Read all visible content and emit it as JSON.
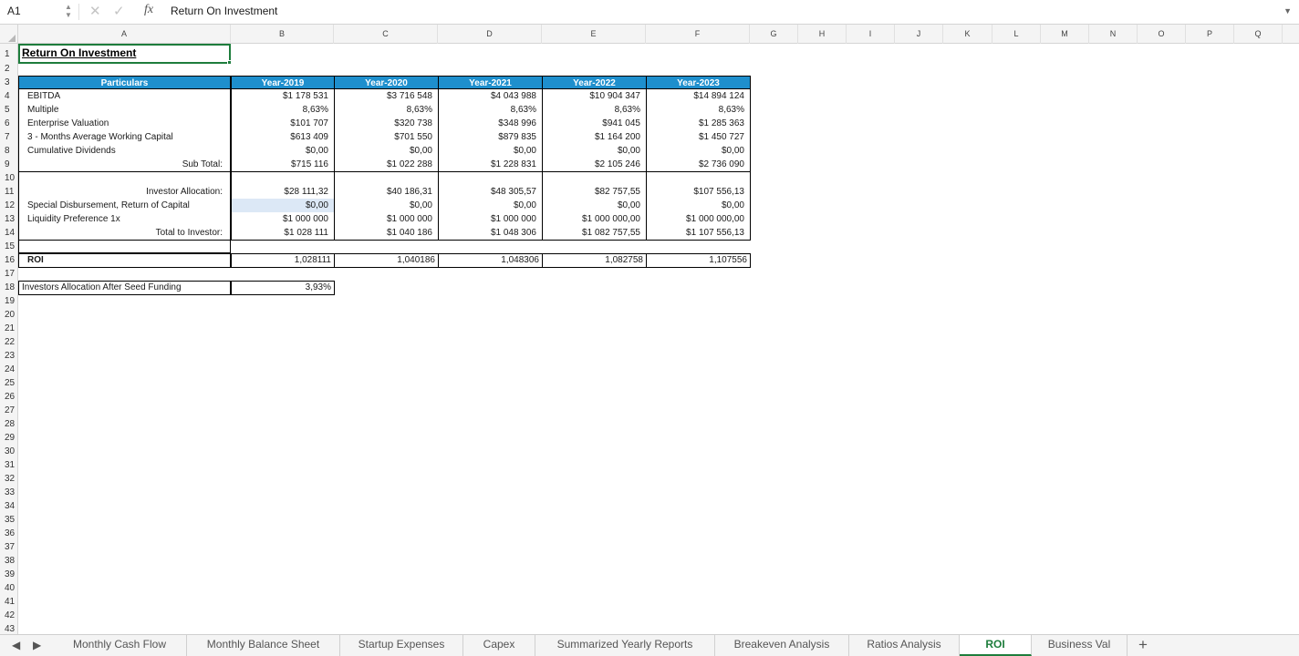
{
  "formula_bar": {
    "cell_ref": "A1",
    "formula_icon": "fx",
    "value": "Return On Investment"
  },
  "columns": [
    "A",
    "B",
    "C",
    "D",
    "E",
    "F",
    "G",
    "H",
    "I",
    "J",
    "K",
    "L",
    "M",
    "N",
    "O",
    "P",
    "Q"
  ],
  "rows": [
    "1",
    "2",
    "3",
    "4",
    "5",
    "6",
    "7",
    "8",
    "9",
    "10",
    "11",
    "12",
    "13",
    "14",
    "15",
    "16",
    "17",
    "18",
    "19",
    "20",
    "21",
    "22",
    "23",
    "24",
    "25",
    "26",
    "27",
    "28",
    "29",
    "30",
    "31",
    "32",
    "33",
    "34",
    "35",
    "36",
    "37",
    "38",
    "39",
    "40",
    "41",
    "42",
    "43"
  ],
  "sheet": {
    "title": "Return On Investment",
    "header": {
      "particulars": "Particulars",
      "years": [
        "Year-2019",
        "Year-2020",
        "Year-2021",
        "Year-2022",
        "Year-2023"
      ]
    },
    "rows": [
      {
        "label": "EBITDA",
        "values": [
          "$1 178 531",
          "$3 716 548",
          "$4 043 988",
          "$10 904 347",
          "$14 894 124"
        ]
      },
      {
        "label": "Multiple",
        "values": [
          "8,63%",
          "8,63%",
          "8,63%",
          "8,63%",
          "8,63%"
        ]
      },
      {
        "label": "Enterprise Valuation",
        "values": [
          "$101 707",
          "$320 738",
          "$348 996",
          "$941 045",
          "$1 285 363"
        ]
      },
      {
        "label": "3 - Months Average Working Capital",
        "values": [
          "$613 409",
          "$701 550",
          "$879 835",
          "$1 164 200",
          "$1 450 727"
        ]
      },
      {
        "label": "Cumulative Dividends",
        "values": [
          "$0,00",
          "$0,00",
          "$0,00",
          "$0,00",
          "$0,00"
        ]
      },
      {
        "label": "Sub Total:",
        "values": [
          "$715 116",
          "$1 022 288",
          "$1 228 831",
          "$2 105 246",
          "$2 736 090"
        ]
      }
    ],
    "investor_rows": [
      {
        "label": "Investor Allocation:",
        "values": [
          "$28 111,32",
          "$40 186,31",
          "$48 305,57",
          "$82 757,55",
          "$107 556,13"
        ]
      },
      {
        "label": "Special Disbursement, Return of Capital",
        "values": [
          "$0,00",
          "$0,00",
          "$0,00",
          "$0,00",
          "$0,00"
        ]
      },
      {
        "label": "Liquidity Preference 1x",
        "values": [
          "$1 000 000",
          "$1 000 000",
          "$1 000 000",
          "$1 000 000,00",
          "$1 000 000,00"
        ]
      },
      {
        "label": "Total to Investor:",
        "values": [
          "$1 028 111",
          "$1 040 186",
          "$1 048 306",
          "$1 082 757,55",
          "$1 107 556,13"
        ]
      }
    ],
    "roi": {
      "label": "ROI",
      "values": [
        "1,028111",
        "1,040186",
        "1,048306",
        "1,082758",
        "1,107556"
      ]
    },
    "seed": {
      "label": "Investors Allocation After Seed Funding",
      "value": "3,93%"
    }
  },
  "tabs": [
    {
      "label": "Monthly Cash Flow"
    },
    {
      "label": "Monthly Balance Sheet"
    },
    {
      "label": "Startup Expenses"
    },
    {
      "label": "Capex"
    },
    {
      "label": "Summarized Yearly Reports"
    },
    {
      "label": "Breakeven Analysis"
    },
    {
      "label": "Ratios Analysis"
    },
    {
      "label": "ROI"
    },
    {
      "label": "Business Val"
    }
  ],
  "active_tab": "ROI",
  "colors": {
    "header_blue": "#1e8fcd",
    "selection_green": "#1e7d3c",
    "highlight": "#dce8f6"
  }
}
